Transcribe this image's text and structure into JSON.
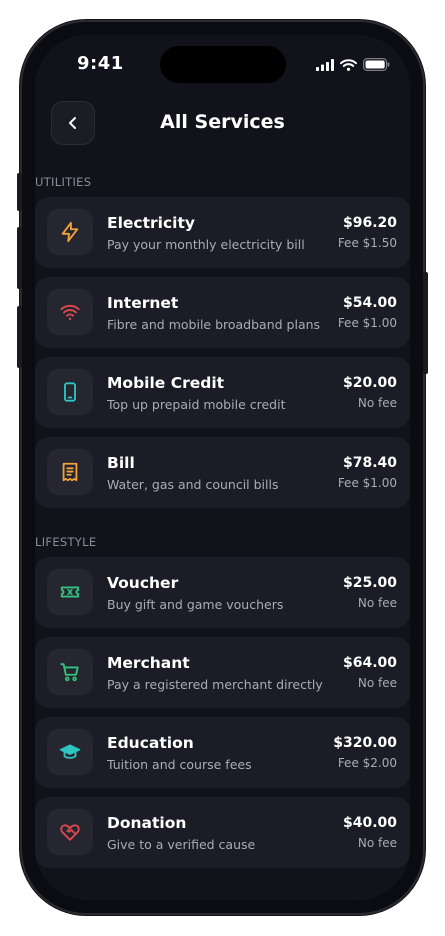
{
  "status_bar": {
    "time": "9:41"
  },
  "header": {
    "title": "All Services"
  },
  "sections": [
    {
      "label": "UTILITIES",
      "items": [
        {
          "title": "Electricity",
          "description": "Pay your monthly electricity bill",
          "amount": "$96.20",
          "fee": "Fee $1.50",
          "icon": "lightning-icon",
          "color": "#f2a33a"
        },
        {
          "title": "Internet",
          "description": "Fibre and mobile broadband plans",
          "amount": "$54.00",
          "fee": "Fee $1.00",
          "icon": "wifi-icon",
          "color": "#e0484e"
        },
        {
          "title": "Mobile Credit",
          "description": "Top up prepaid mobile credit",
          "amount": "$20.00",
          "fee": "No fee",
          "icon": "mobile-phone-icon",
          "color": "#2fc5c0"
        },
        {
          "title": "Bill",
          "description": "Water, gas and council bills",
          "amount": "$78.40",
          "fee": "Fee $1.00",
          "icon": "receipt-icon",
          "color": "#f2a33a"
        }
      ]
    },
    {
      "label": "LIFESTYLE",
      "items": [
        {
          "title": "Voucher",
          "description": "Buy gift and game vouchers",
          "amount": "$25.00",
          "fee": "No fee",
          "icon": "ticket-icon",
          "color": "#33c37e"
        },
        {
          "title": "Merchant",
          "description": "Pay a registered merchant directly",
          "amount": "$64.00",
          "fee": "No fee",
          "icon": "shopping-cart-icon",
          "color": "#33c37e"
        },
        {
          "title": "Education",
          "description": "Tuition and course fees",
          "amount": "$320.00",
          "fee": "Fee $2.00",
          "icon": "graduation-cap-icon",
          "color": "#2fc5c0"
        },
        {
          "title": "Donation",
          "description": "Give to a verified cause",
          "amount": "$40.00",
          "fee": "No fee",
          "icon": "heart-handshake-icon",
          "color": "#e0484e"
        }
      ]
    }
  ]
}
